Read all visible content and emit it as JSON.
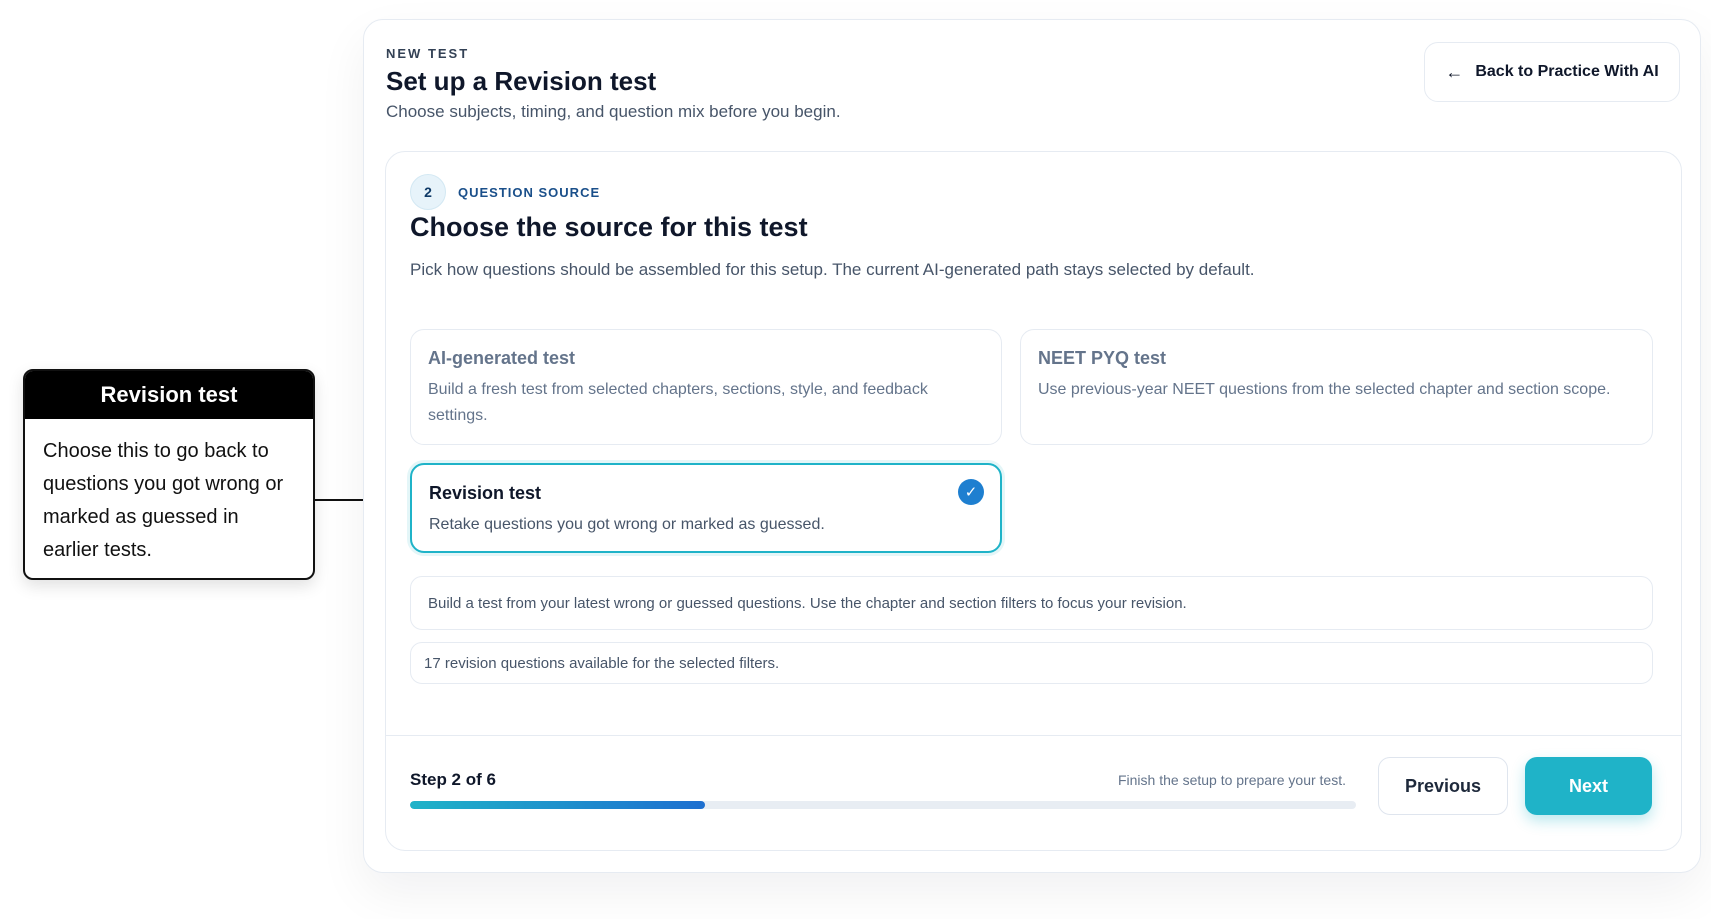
{
  "callout": {
    "title": "Revision test",
    "body": "Choose this to go back to questions you got wrong or marked as guessed in earlier tests."
  },
  "header": {
    "eyebrow": "NEW TEST",
    "title": "Set up a Revision test",
    "subtitle": "Choose subjects, timing, and question mix before you begin.",
    "back_icon": "arrow-left-icon",
    "back_label": "Back to Practice With AI"
  },
  "step": {
    "number": "2",
    "label": "QUESTION SOURCE",
    "title": "Choose the source for this test",
    "description": "Pick how questions should be assembled for this setup. The current AI-generated path stays selected by default."
  },
  "options": [
    {
      "title": "AI-generated test",
      "description": "Build a fresh test from selected chapters, sections, style, and feedback settings.",
      "selected": false
    },
    {
      "title": "NEET PYQ test",
      "description": "Use previous-year NEET questions from the selected chapter and section scope.",
      "selected": false
    },
    {
      "title": "Revision test",
      "description": "Retake questions you got wrong or marked as guessed.",
      "selected": true,
      "check_icon": "check-circle-icon"
    }
  ],
  "info": {
    "revision_note": "Build a test from your latest wrong or guessed questions. Use the chapter and section filters to focus your revision.",
    "available": "17 revision questions available for the selected filters."
  },
  "footer": {
    "step_label": "Step 2 of 6",
    "hint": "Finish the setup to prepare your test.",
    "progress_percent": 31.2,
    "previous_label": "Previous",
    "next_label": "Next"
  },
  "colors": {
    "accent": "#1fb3c8",
    "check": "#1e7fd0",
    "progress_end": "#1e6fd0"
  }
}
